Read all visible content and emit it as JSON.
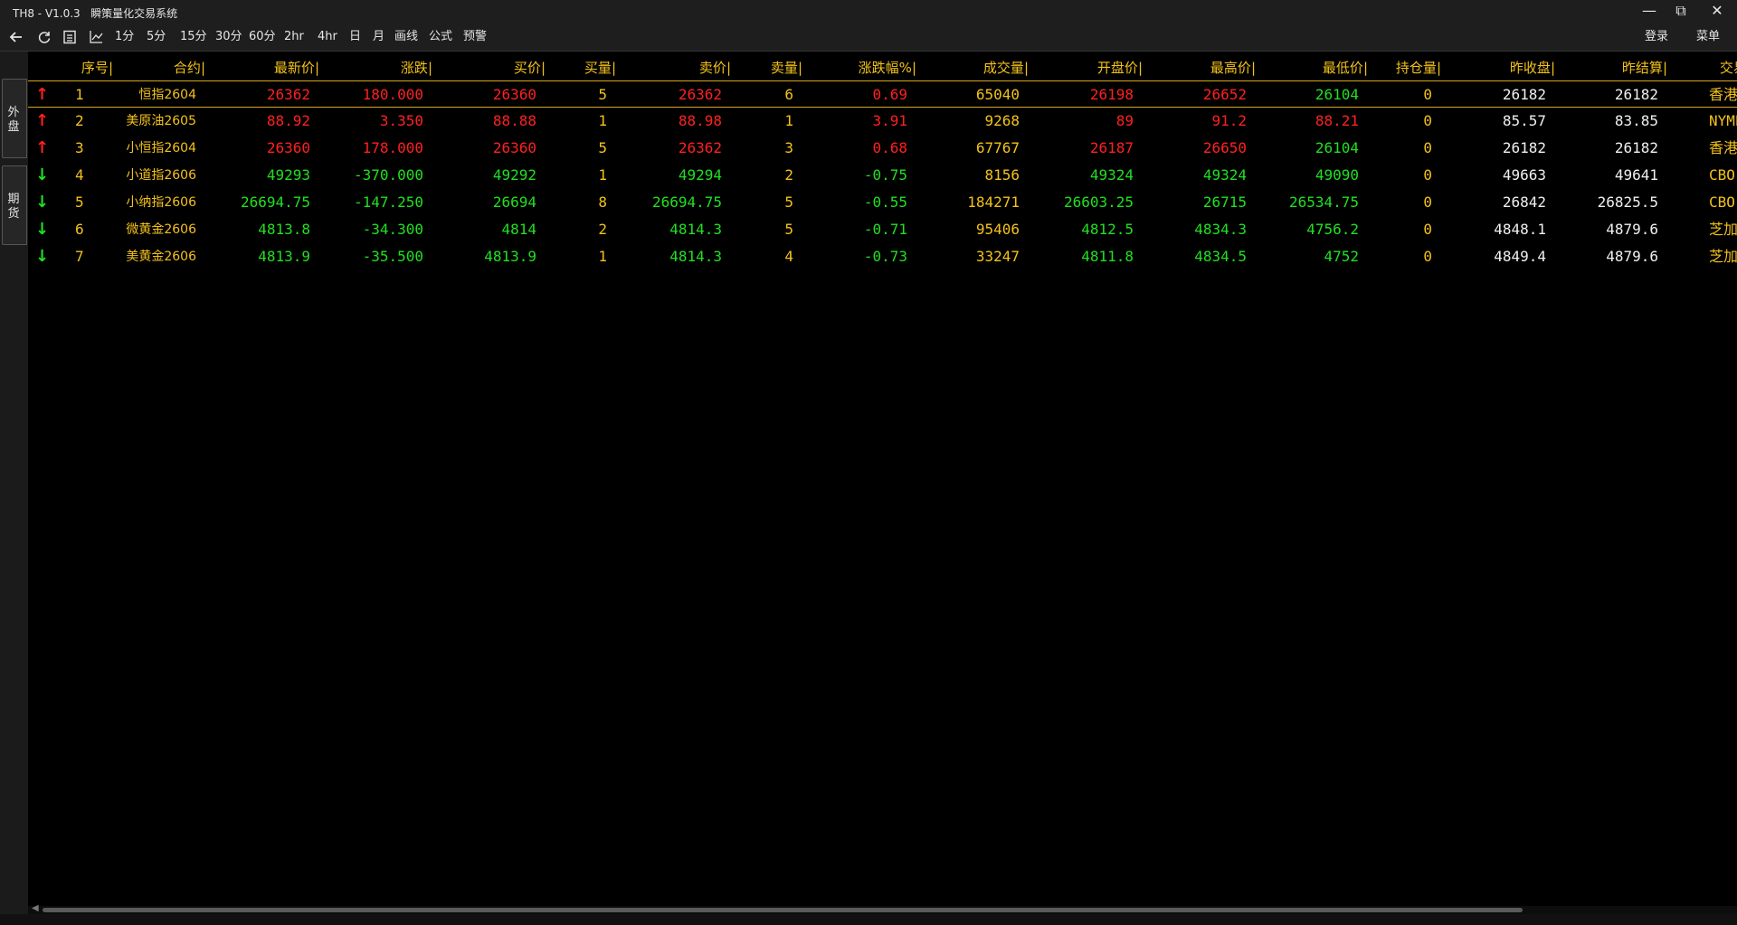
{
  "window": {
    "title": "TH8 - V1.0.3   瞬策量化交易系统",
    "minimize": "—",
    "maximize": "⧉",
    "close": "✕"
  },
  "toolbar": {
    "intervals": [
      "1分",
      "5分",
      "15分",
      "30分",
      "60分",
      "2hr",
      "4hr",
      "日",
      "月"
    ],
    "draw": "画线",
    "formula": "公式",
    "alert": "预警",
    "login": "登录",
    "menu": "菜单",
    "icons": [
      "back-arrow-icon",
      "refresh-icon",
      "list-icon",
      "line-chart-icon"
    ]
  },
  "sidetabs": [
    {
      "label": "外\n盘"
    },
    {
      "label": "期\n货"
    }
  ],
  "table": {
    "columns": [
      "序号",
      "合约",
      "最新价",
      "涨跌",
      "买价",
      "买量",
      "卖价",
      "卖量",
      "涨跌幅%",
      "成交量",
      "开盘价",
      "最高价",
      "最低价",
      "持仓量",
      "昨收盘",
      "昨结算",
      "交易所"
    ],
    "rows": [
      {
        "dir": "up",
        "idx": "1",
        "name": "恒指2604",
        "last": "26362",
        "chg": "180.000",
        "bid": "26360",
        "bidv": "5",
        "ask": "26362",
        "askv": "6",
        "pct": "0.69",
        "vol": "65040",
        "open": "26198",
        "high": "26652",
        "low": "26104",
        "oi": "0",
        "preclose": "26182",
        "presettle": "26182",
        "exch": "香港"
      },
      {
        "dir": "up",
        "idx": "2",
        "name": "美原油2605",
        "last": "88.92",
        "chg": "3.350",
        "bid": "88.88",
        "bidv": "1",
        "ask": "88.98",
        "askv": "1",
        "pct": "3.91",
        "vol": "9268",
        "open": "89",
        "high": "91.2",
        "low": "88.21",
        "oi": "0",
        "preclose": "85.57",
        "presettle": "83.85",
        "exch": "NYME"
      },
      {
        "dir": "up",
        "idx": "3",
        "name": "小恒指2604",
        "last": "26360",
        "chg": "178.000",
        "bid": "26360",
        "bidv": "5",
        "ask": "26362",
        "askv": "3",
        "pct": "0.68",
        "vol": "67767",
        "open": "26187",
        "high": "26650",
        "low": "26104",
        "oi": "0",
        "preclose": "26182",
        "presettle": "26182",
        "exch": "香港"
      },
      {
        "dir": "down",
        "idx": "4",
        "name": "小道指2606",
        "last": "49293",
        "chg": "-370.000",
        "bid": "49292",
        "bidv": "1",
        "ask": "49294",
        "askv": "2",
        "pct": "-0.75",
        "vol": "8156",
        "open": "49324",
        "high": "49324",
        "low": "49090",
        "oi": "0",
        "preclose": "49663",
        "presettle": "49641",
        "exch": "CBO"
      },
      {
        "dir": "down",
        "idx": "5",
        "name": "小纳指2606",
        "last": "26694.75",
        "chg": "-147.250",
        "bid": "26694",
        "bidv": "8",
        "ask": "26694.75",
        "askv": "5",
        "pct": "-0.55",
        "vol": "184271",
        "open": "26603.25",
        "high": "26715",
        "low": "26534.75",
        "oi": "0",
        "preclose": "26842",
        "presettle": "26825.5",
        "exch": "CBO"
      },
      {
        "dir": "down",
        "idx": "6",
        "name": "微黄金2606",
        "last": "4813.8",
        "chg": "-34.300",
        "bid": "4814",
        "bidv": "2",
        "ask": "4814.3",
        "askv": "5",
        "pct": "-0.71",
        "vol": "95406",
        "open": "4812.5",
        "high": "4834.3",
        "low": "4756.2",
        "oi": "0",
        "preclose": "4848.1",
        "presettle": "4879.6",
        "exch": "芝加哥"
      },
      {
        "dir": "down",
        "idx": "7",
        "name": "美黄金2606",
        "last": "4813.9",
        "chg": "-35.500",
        "bid": "4813.9",
        "bidv": "1",
        "ask": "4814.3",
        "askv": "4",
        "pct": "-0.73",
        "vol": "33247",
        "open": "4811.8",
        "high": "4834.5",
        "low": "4752",
        "oi": "0",
        "preclose": "4849.4",
        "presettle": "4879.6",
        "exch": "芝加哥"
      }
    ]
  },
  "colors": {
    "up": "#ff2020",
    "down": "#20e020",
    "header": "#f3c21a",
    "neutral": "#f0f0f0"
  }
}
